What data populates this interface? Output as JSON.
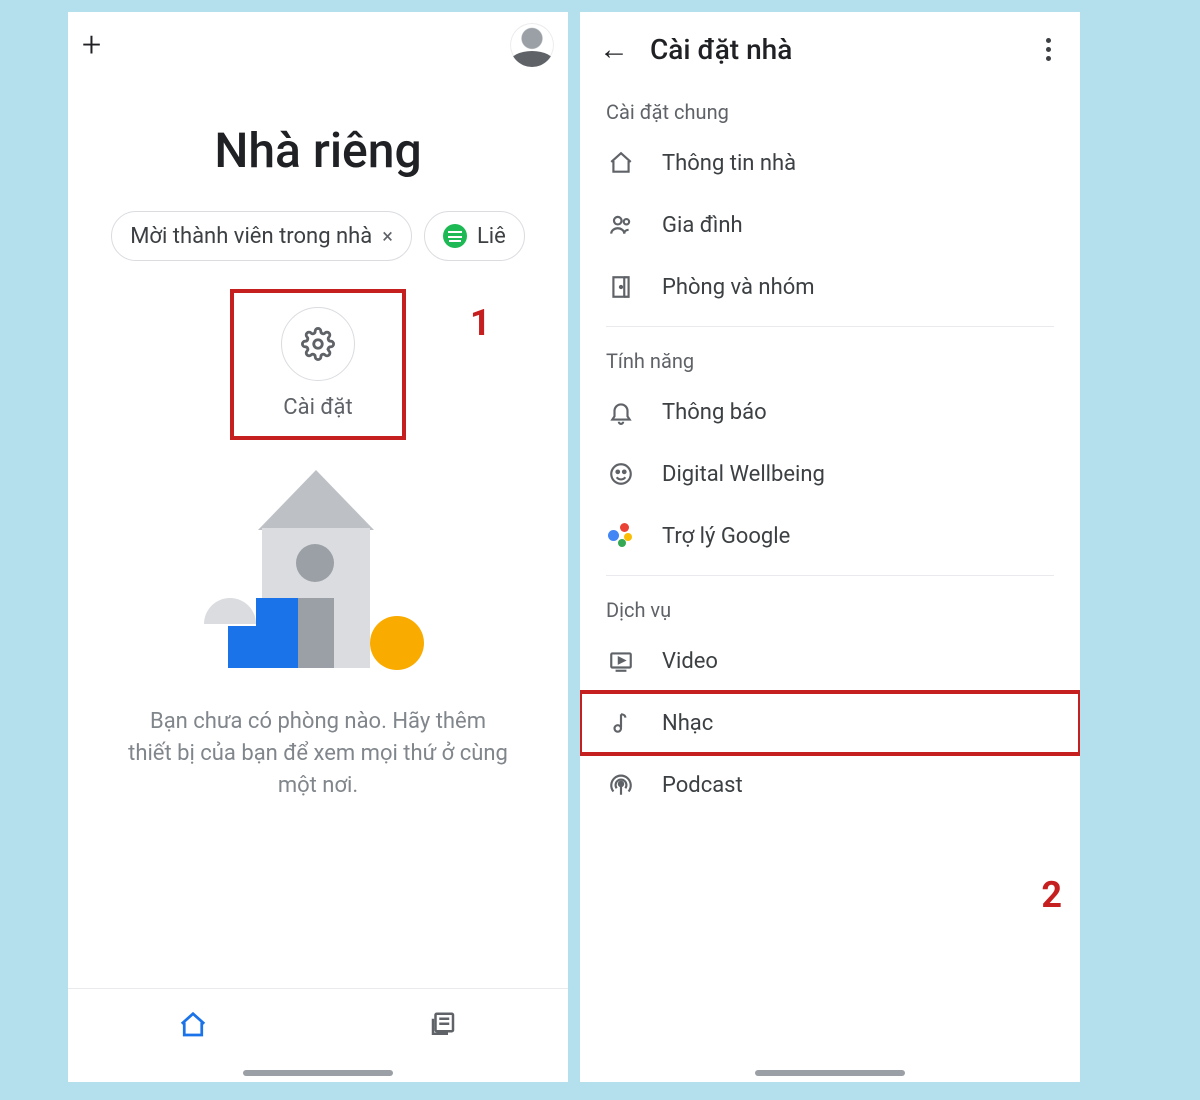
{
  "annotations": {
    "callout1": "1",
    "callout2": "2"
  },
  "left": {
    "title": "Nhà riêng",
    "chip_invite": "Mời thành viên trong nhà",
    "chip_invite_close": "×",
    "chip_link_partial": "Liê",
    "settings_label": "Cài đặt",
    "empty_message": "Bạn chưa có phòng nào. Hãy thêm thiết bị của bạn để xem mọi thứ ở cùng một nơi."
  },
  "right": {
    "title": "Cài đặt nhà",
    "section_general": "Cài đặt chung",
    "rows_general": {
      "home_info": "Thông tin nhà",
      "household": "Gia đình",
      "rooms": "Phòng và nhóm"
    },
    "section_features": "Tính năng",
    "rows_features": {
      "notifications": "Thông báo",
      "wellbeing": "Digital Wellbeing",
      "assistant": "Trợ lý Google"
    },
    "section_services": "Dịch vụ",
    "rows_services": {
      "video": "Video",
      "music": "Nhạc",
      "podcast": "Podcast"
    }
  }
}
